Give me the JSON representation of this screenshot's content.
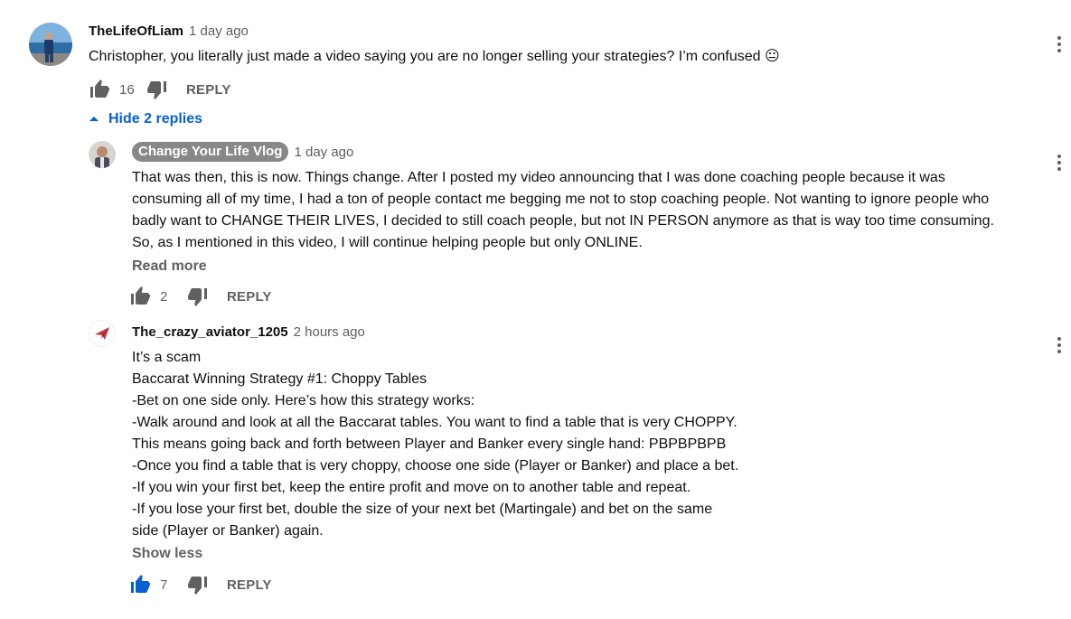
{
  "comments": [
    {
      "author": "TheLifeOfLiam",
      "time": "1 day ago",
      "text": "Christopher, you literally just made a video saying you are no longer selling your strategies? I’m confused 😐",
      "likes": "16",
      "reply_label": "REPLY"
    }
  ],
  "replies_toggle": "Hide 2 replies",
  "replies": [
    {
      "author": "Change Your Life Vlog",
      "time": "1 day ago",
      "text": "That was then, this is now. Things change. After I posted my video announcing that I was done coaching people because it was\nconsuming all of my time, I had a ton of people contact me begging me not to stop coaching people. Not wanting to ignore people who\nbadly want to CHANGE THEIR LIVES, I decided to still coach people, but not  IN PERSON anymore as that is way too time consuming.\nSo, as I mentioned in this video, I will continue helping people but only ONLINE.",
      "more_label": "Read more",
      "likes": "2",
      "reply_label": "REPLY"
    },
    {
      "author": "The_crazy_aviator_1205",
      "time": "2 hours ago",
      "text": "It’s a scam\nBaccarat Winning Strategy #1: Choppy Tables\n-Bet on one side only. Here’s how this strategy works:\n-Walk around and look at all the Baccarat tables. You want to find a table that is very CHOPPY.\nThis means going back and forth between Player and Banker every single hand: PBPBPBPB\n-Once you find a table that is very choppy, choose one side (Player or Banker) and place a bet.\n-If you win your first bet, keep the entire profit and move on to another table and repeat.\n-If you lose your first bet, double the size of your next bet (Martingale) and bet on the same\nside (Player or Banker) again.",
      "more_label": "Show less",
      "likes": "7",
      "reply_label": "REPLY"
    }
  ],
  "colors": {
    "link_blue": "#065fd4",
    "secondary_text": "#606060",
    "owner_badge": "#888888"
  },
  "icons": [
    "thumbs-up-icon",
    "thumbs-down-icon",
    "more-vert-icon",
    "caret-up-icon"
  ]
}
